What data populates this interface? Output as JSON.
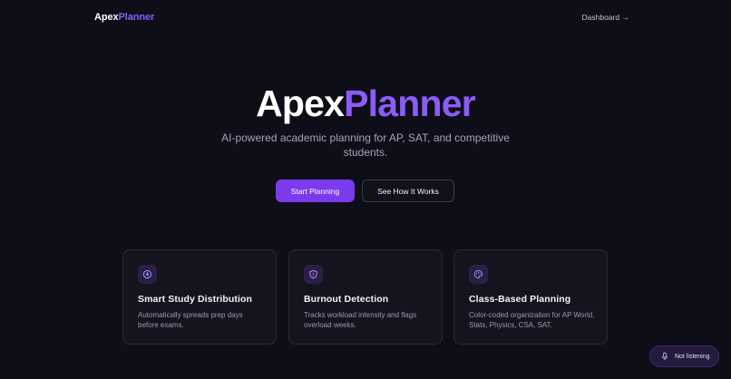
{
  "nav": {
    "logo_part1": "Apex",
    "logo_part2": "Planner",
    "dashboard_link": "Dashboard →"
  },
  "hero": {
    "title_part1": "Apex",
    "title_part2": "Planner",
    "subtitle": "AI-powered academic planning for AP, SAT, and competitive students.",
    "primary_button": "Start Planning",
    "secondary_button": "See How It Works"
  },
  "features": [
    {
      "icon": "brain-icon",
      "title": "Smart Study Distribution",
      "description": "Automatically spreads prep days before exams."
    },
    {
      "icon": "shield-icon",
      "title": "Burnout Detection",
      "description": "Tracks workload intensity and flags overload weeks."
    },
    {
      "icon": "palette-icon",
      "title": "Class-Based Planning",
      "description": "Color-coded organization for AP World, Stats, Physics, CSA, SAT."
    }
  ],
  "voice": {
    "icon": "microphone-icon",
    "status": "Not listening"
  },
  "colors": {
    "background": "#0e0e18",
    "accent": "#8b5cf6",
    "primary_button": "#7c3aed",
    "card_background": "#14141f"
  }
}
